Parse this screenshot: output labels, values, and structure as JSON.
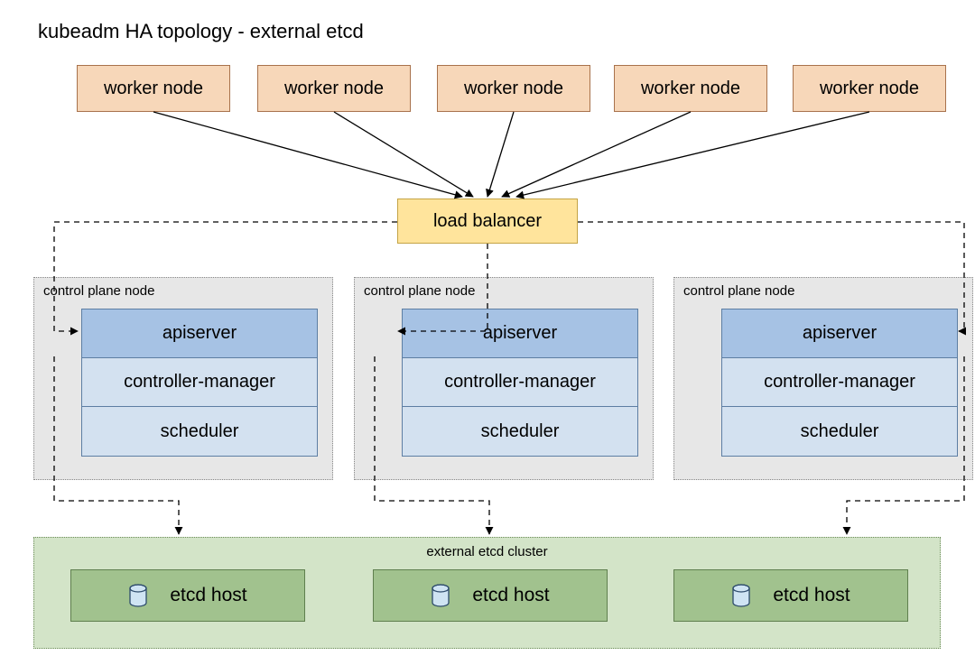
{
  "title": "kubeadm HA topology - external etcd",
  "workers": [
    "worker node",
    "worker node",
    "worker node",
    "worker node",
    "worker node"
  ],
  "load_balancer": "load balancer",
  "control_planes": [
    {
      "label": "control plane node",
      "rows": [
        "apiserver",
        "controller-manager",
        "scheduler"
      ]
    },
    {
      "label": "control plane node",
      "rows": [
        "apiserver",
        "controller-manager",
        "scheduler"
      ]
    },
    {
      "label": "control plane node",
      "rows": [
        "apiserver",
        "controller-manager",
        "scheduler"
      ]
    }
  ],
  "etcd_cluster": {
    "label": "external etcd cluster",
    "hosts": [
      "etcd host",
      "etcd host",
      "etcd host"
    ]
  },
  "colors": {
    "worker_fill": "#f7d7b9",
    "worker_border": "#a8724c",
    "lb_fill": "#ffe49c",
    "lb_border": "#c4a445",
    "cp_fill": "#e7e7e7",
    "api_fill": "#a6c2e4",
    "row_fill": "#d3e1f0",
    "row_border": "#5d7ea3",
    "etcd_cluster_fill": "#d3e4c8",
    "etcd_cluster_border": "#6d8d5a",
    "etcd_host_fill": "#a1c28e",
    "etcd_host_border": "#5f7f4e"
  }
}
